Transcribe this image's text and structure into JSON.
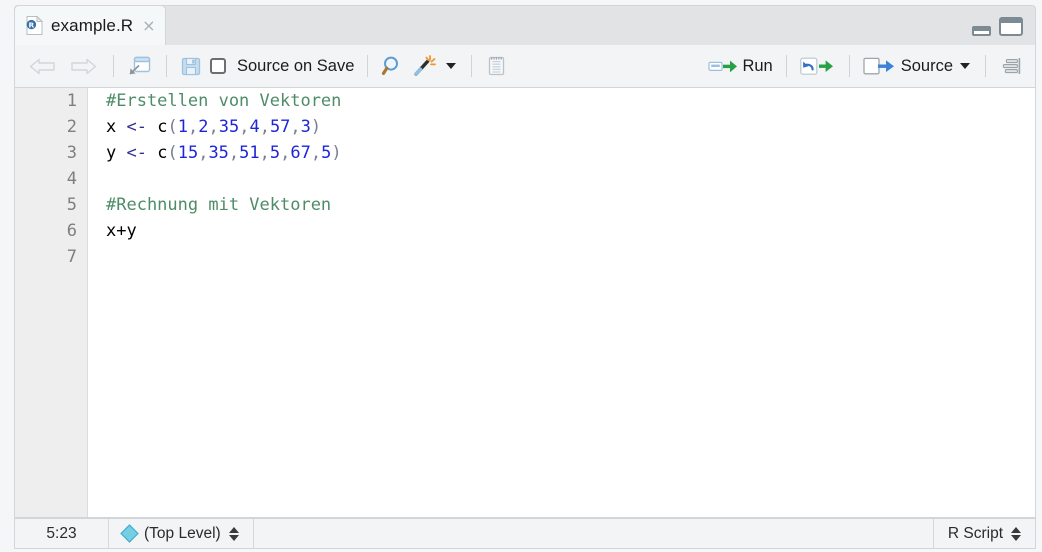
{
  "window": {
    "minimize_icon": "minimize-pane-icon",
    "maximize_icon": "maximize-pane-icon"
  },
  "tab": {
    "label": "example.R",
    "close_label": "×",
    "file_icon": "r-script-file-icon",
    "icon_letter": "R"
  },
  "toolbar": {
    "back_icon": "back-arrow-icon",
    "forward_icon": "forward-arrow-icon",
    "popout_icon": "show-in-new-window-icon",
    "save_icon": "save-icon",
    "source_on_save_label": "Source on Save",
    "find_icon": "magnifier-icon",
    "code_tools_icon": "magic-wand-icon",
    "code_tools_caret": "chevron-down-icon",
    "compile_report_icon": "notebook-icon",
    "run_label": "Run",
    "run_icon": "run-icon",
    "rerun_icon": "rerun-icon",
    "source_label": "Source",
    "source_icon": "source-icon",
    "source_caret": "chevron-down-icon",
    "outline_icon": "document-outline-icon"
  },
  "editor": {
    "gutter": [
      "1",
      "2",
      "3",
      "4",
      "5",
      "6",
      "7"
    ],
    "lines": [
      {
        "tokens": [
          {
            "t": "comment",
            "v": "#Erstellen von Vektoren"
          }
        ]
      },
      {
        "tokens": [
          {
            "t": "ident",
            "v": "x "
          },
          {
            "t": "op",
            "v": "<- "
          },
          {
            "t": "ident",
            "v": "c"
          },
          {
            "t": "punct",
            "v": "("
          },
          {
            "t": "num",
            "v": "1"
          },
          {
            "t": "punct",
            "v": ","
          },
          {
            "t": "num",
            "v": "2"
          },
          {
            "t": "punct",
            "v": ","
          },
          {
            "t": "num",
            "v": "35"
          },
          {
            "t": "punct",
            "v": ","
          },
          {
            "t": "num",
            "v": "4"
          },
          {
            "t": "punct",
            "v": ","
          },
          {
            "t": "num",
            "v": "57"
          },
          {
            "t": "punct",
            "v": ","
          },
          {
            "t": "num",
            "v": "3"
          },
          {
            "t": "punct",
            "v": ")"
          }
        ]
      },
      {
        "tokens": [
          {
            "t": "ident",
            "v": "y "
          },
          {
            "t": "op",
            "v": "<- "
          },
          {
            "t": "ident",
            "v": "c"
          },
          {
            "t": "punct",
            "v": "("
          },
          {
            "t": "num",
            "v": "15"
          },
          {
            "t": "punct",
            "v": ","
          },
          {
            "t": "num",
            "v": "35"
          },
          {
            "t": "punct",
            "v": ","
          },
          {
            "t": "num",
            "v": "51"
          },
          {
            "t": "punct",
            "v": ","
          },
          {
            "t": "num",
            "v": "5"
          },
          {
            "t": "punct",
            "v": ","
          },
          {
            "t": "num",
            "v": "67"
          },
          {
            "t": "punct",
            "v": ","
          },
          {
            "t": "num",
            "v": "5"
          },
          {
            "t": "punct",
            "v": ")"
          }
        ]
      },
      {
        "tokens": []
      },
      {
        "tokens": [
          {
            "t": "comment",
            "v": "#Rechnung mit Vektoren"
          }
        ]
      },
      {
        "tokens": [
          {
            "t": "ident",
            "v": "x+y"
          }
        ]
      },
      {
        "tokens": []
      }
    ]
  },
  "statusbar": {
    "cursor_position": "5:23",
    "scope_icon": "scope-diamond-icon",
    "scope_label": "(Top Level)",
    "scope_stepper": "up-down-stepper-icon",
    "doc_type_label": "R Script",
    "doc_type_stepper": "up-down-stepper-icon"
  },
  "colors": {
    "comment": "#4e8c68",
    "number": "#1d26d8",
    "accent_blue": "#3b7dd8",
    "run_green": "#2a9a46",
    "diamond": "#74cee4"
  }
}
